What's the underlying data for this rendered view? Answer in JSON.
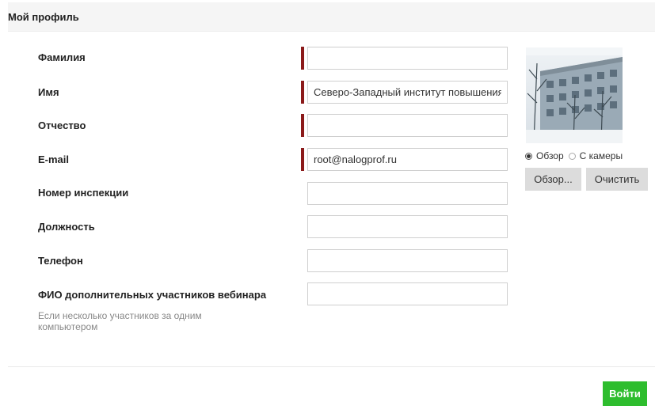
{
  "header": {
    "title": "Мой профиль"
  },
  "form": {
    "fields": [
      {
        "label": "Фамилия",
        "value": "",
        "required": true
      },
      {
        "label": "Имя",
        "value": "Северо-Западный институт повышения квалификации",
        "required": true
      },
      {
        "label": "Отчество",
        "value": "",
        "required": true
      },
      {
        "label": "E-mail",
        "value": "root@nalogprof.ru",
        "required": true
      },
      {
        "label": "Номер инспекции",
        "value": "",
        "required": false
      },
      {
        "label": "Должность",
        "value": "",
        "required": false
      },
      {
        "label": "Телефон",
        "value": "",
        "required": false
      },
      {
        "label": "ФИО дополнительных участников вебинара",
        "value": "",
        "required": false,
        "hint": "Если несколько участников за одним компьютером"
      }
    ]
  },
  "photo": {
    "source_options": [
      {
        "label": "Обзор",
        "selected": true
      },
      {
        "label": "С камеры",
        "selected": false
      }
    ],
    "browse_button": "Обзор...",
    "clear_button": "Очистить"
  },
  "footer": {
    "login_button": "Войти"
  },
  "colors": {
    "required_marker": "#8b1a1a",
    "login_button": "#2ebd2e",
    "secondary_button": "#dcdcdc"
  }
}
